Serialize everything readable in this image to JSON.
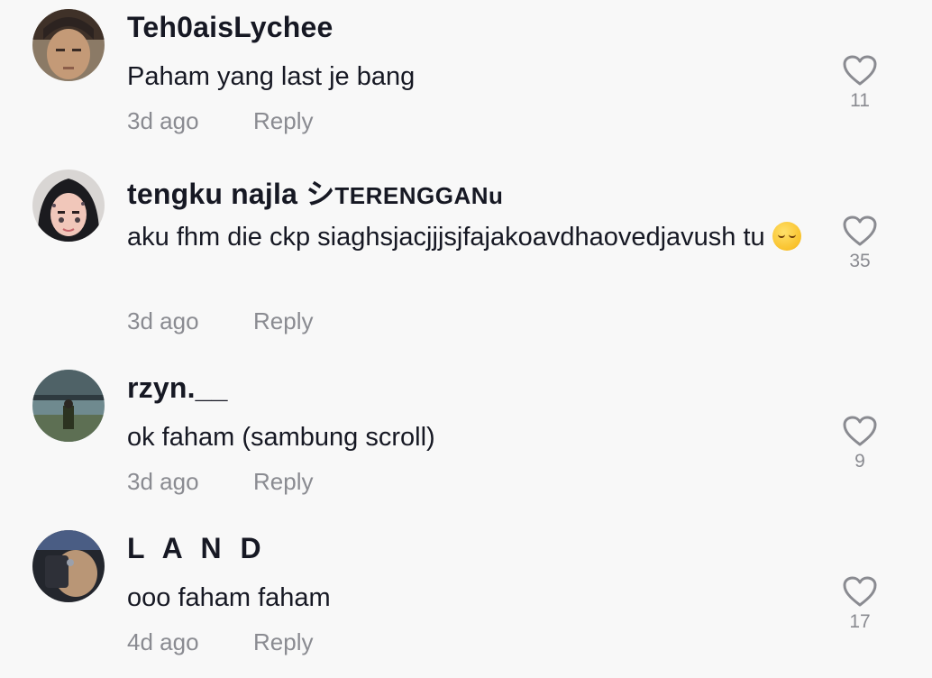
{
  "comments": [
    {
      "username": "Teh0aisLychee",
      "username_suffix": "",
      "text": "Paham yang last je bang",
      "emoji": "",
      "time": "3d ago",
      "reply_label": "Reply",
      "like_count": "11"
    },
    {
      "username": "tengku najla シ",
      "username_suffix": "TERENGGANu",
      "text": "aku fhm die ckp siaghsjacjjjsjfajakoavdhaovedjavush tu",
      "emoji": "relieved-face-emoji",
      "time": "3d ago",
      "reply_label": "Reply",
      "like_count": "35"
    },
    {
      "username": "rzyn.__",
      "username_suffix": "",
      "text": "ok faham (sambung scroll)",
      "emoji": "",
      "time": "3d ago",
      "reply_label": "Reply",
      "like_count": "9"
    },
    {
      "username": "L A N D",
      "username_suffix": "",
      "text": "ooo faham faham",
      "emoji": "",
      "time": "4d ago",
      "reply_label": "Reply",
      "like_count": "17"
    }
  ],
  "colors": {
    "background": "#f8f8f8",
    "primary_text": "#161823",
    "secondary_text": "#8a8b91",
    "icon": "#8a8b91"
  },
  "icons": {
    "like": "heart-outline-icon"
  }
}
